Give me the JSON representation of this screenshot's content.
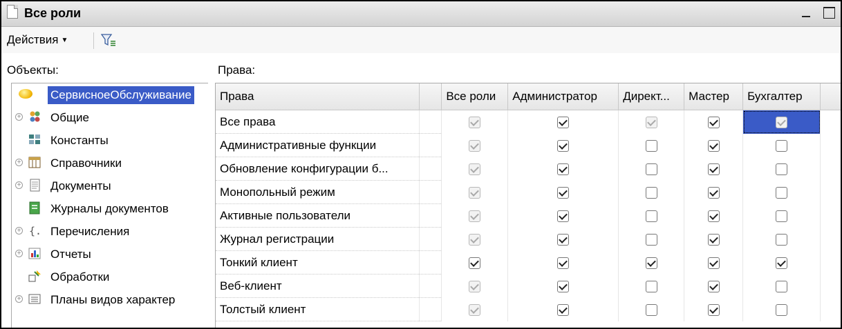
{
  "window": {
    "title": "Все роли"
  },
  "toolbar": {
    "actions_label": "Действия"
  },
  "labels": {
    "objects": "Объекты:",
    "rights": "Права:"
  },
  "tree": [
    {
      "label": "СервисноеОбслуживание",
      "icon": "config-root-icon",
      "expandable": false,
      "selected": true
    },
    {
      "label": "Общие",
      "icon": "common-icon",
      "expandable": true
    },
    {
      "label": "Константы",
      "icon": "constants-icon",
      "expandable": false
    },
    {
      "label": "Справочники",
      "icon": "catalogs-icon",
      "expandable": true
    },
    {
      "label": "Документы",
      "icon": "documents-icon",
      "expandable": true
    },
    {
      "label": "Журналы документов",
      "icon": "document-journals-icon",
      "expandable": false
    },
    {
      "label": "Перечисления",
      "icon": "enumerations-icon",
      "expandable": true
    },
    {
      "label": "Отчеты",
      "icon": "reports-icon",
      "expandable": true
    },
    {
      "label": "Обработки",
      "icon": "data-processors-icon",
      "expandable": false
    },
    {
      "label": "Планы видов характер",
      "icon": "characteristic-types-icon",
      "expandable": true
    }
  ],
  "grid": {
    "columns": [
      "Права",
      "",
      "Все роли",
      "Администратор",
      "Директ...",
      "Мастер",
      "Бухгалтер"
    ],
    "rows": [
      {
        "name": "Все права",
        "values": [
          true,
          true,
          true,
          true,
          true
        ],
        "disabled": [
          true,
          false,
          true,
          false,
          true
        ]
      },
      {
        "name": "Административные функции",
        "values": [
          true,
          true,
          false,
          true,
          false
        ],
        "disabled": [
          true,
          false,
          false,
          false,
          false
        ]
      },
      {
        "name": "Обновление конфигурации б...",
        "values": [
          true,
          true,
          false,
          true,
          false
        ],
        "disabled": [
          true,
          false,
          false,
          false,
          false
        ]
      },
      {
        "name": "Монопольный режим",
        "values": [
          true,
          true,
          false,
          true,
          false
        ],
        "disabled": [
          true,
          false,
          false,
          false,
          false
        ]
      },
      {
        "name": "Активные пользователи",
        "values": [
          true,
          true,
          false,
          true,
          false
        ],
        "disabled": [
          true,
          false,
          false,
          false,
          false
        ]
      },
      {
        "name": "Журнал регистрации",
        "values": [
          true,
          true,
          false,
          true,
          false
        ],
        "disabled": [
          true,
          false,
          false,
          false,
          false
        ]
      },
      {
        "name": "Тонкий клиент",
        "values": [
          true,
          true,
          true,
          true,
          true
        ],
        "disabled": [
          false,
          false,
          false,
          false,
          false
        ]
      },
      {
        "name": "Веб-клиент",
        "values": [
          true,
          true,
          false,
          true,
          false
        ],
        "disabled": [
          true,
          false,
          false,
          false,
          false
        ]
      },
      {
        "name": "Толстый клиент",
        "values": [
          true,
          true,
          false,
          true,
          false
        ],
        "disabled": [
          true,
          false,
          false,
          false,
          false
        ]
      }
    ],
    "selected_cell": {
      "row": 0,
      "col": 4
    }
  },
  "colors": {
    "selection": "#3a5bc7",
    "titlebar": "#dcdcdc"
  }
}
